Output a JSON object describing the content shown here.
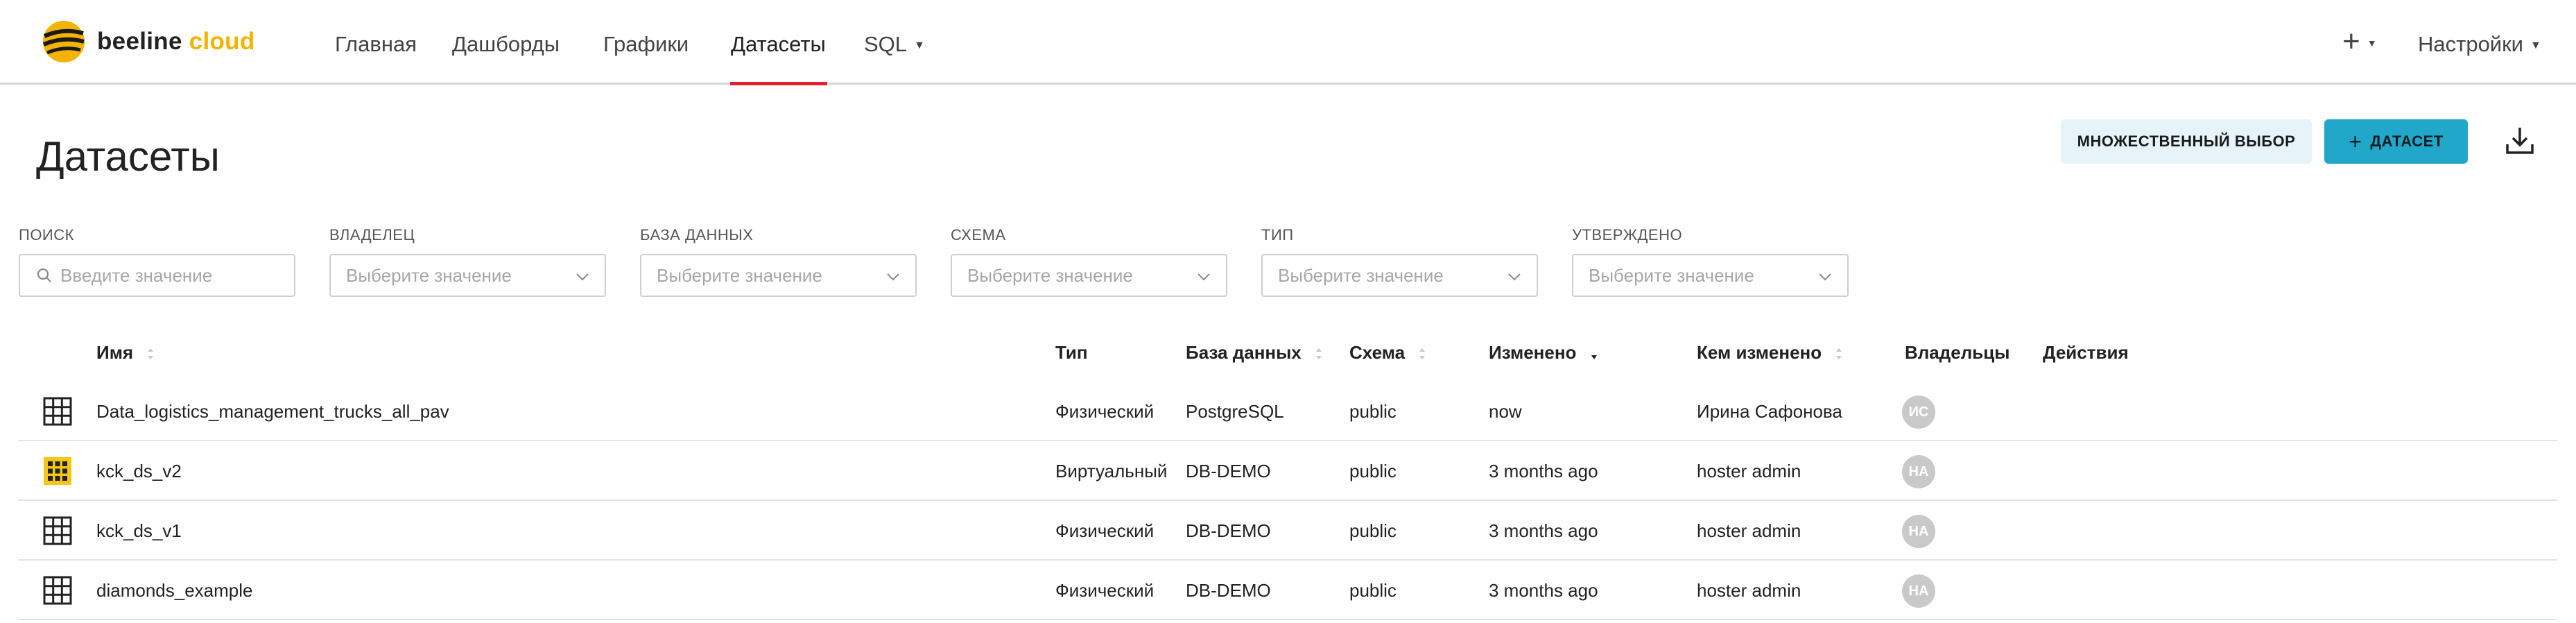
{
  "brand": {
    "name": "beeline",
    "suffix": "cloud",
    "accent": "#f2b400"
  },
  "nav": {
    "items": [
      {
        "label": "Главная"
      },
      {
        "label": "Дашборды"
      },
      {
        "label": "Графики"
      },
      {
        "label": "Датасеты",
        "active": true
      },
      {
        "label": "SQL"
      }
    ],
    "add_label": "+",
    "settings_label": "Настройки",
    "active_color": "#e5202e"
  },
  "page": {
    "title": "Датасеты",
    "multi_select_label": "МНОЖЕСТВЕННЫЙ ВЫБОР",
    "add_dataset_label": "ДАТАСЕТ",
    "add_dataset_color": "#20a7c9"
  },
  "filters": [
    {
      "label": "ПОИСК",
      "placeholder": "Введите значение"
    },
    {
      "label": "ВЛАДЕЛЕЦ",
      "placeholder": "Выберите значение"
    },
    {
      "label": "БАЗА ДАННЫХ",
      "placeholder": "Выберите значение"
    },
    {
      "label": "СХЕМА",
      "placeholder": "Выберите значение"
    },
    {
      "label": "ТИП",
      "placeholder": "Выберите значение"
    },
    {
      "label": "УТВЕРЖДЕНО",
      "placeholder": "Выберите значение"
    }
  ],
  "table": {
    "columns": [
      "Имя",
      "Тип",
      "База данных",
      "Схема",
      "Изменено",
      "Кем изменено",
      "Владельцы",
      "Действия"
    ],
    "rows": [
      {
        "icon": "table-icon",
        "name": "Data_logistics_management_trucks_all_pav",
        "type": "Физический",
        "database": "PostgreSQL",
        "schema": "public",
        "changed": "now",
        "changed_by": "Ирина Сафонова",
        "owner": "ИС"
      },
      {
        "icon": "virtual-table-icon",
        "name": "kck_ds_v2",
        "type": "Виртуальный",
        "database": "DB-DEMO",
        "schema": "public",
        "changed": "3 months ago",
        "changed_by": "hoster admin",
        "owner": "HA"
      },
      {
        "icon": "table-icon",
        "name": "kck_ds_v1",
        "type": "Физический",
        "database": "DB-DEMO",
        "schema": "public",
        "changed": "3 months ago",
        "changed_by": "hoster admin",
        "owner": "HA"
      },
      {
        "icon": "table-icon",
        "name": "diamonds_example",
        "type": "Физический",
        "database": "DB-DEMO",
        "schema": "public",
        "changed": "3 months ago",
        "changed_by": "hoster admin",
        "owner": "HA"
      }
    ]
  }
}
